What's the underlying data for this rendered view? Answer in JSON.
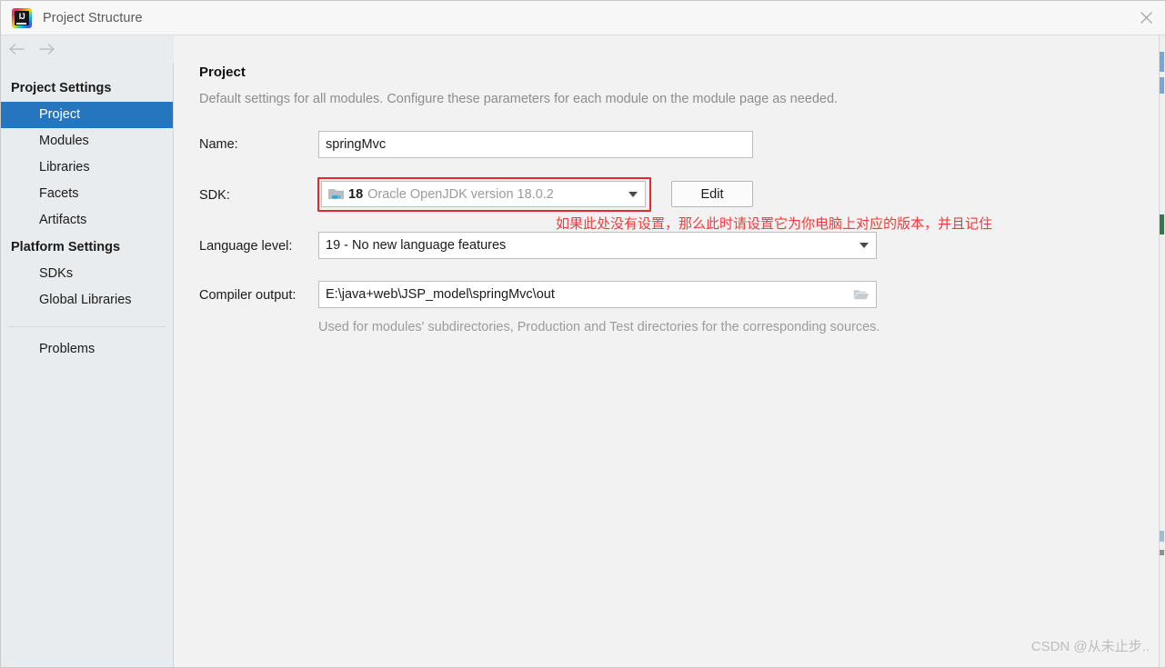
{
  "window": {
    "title": "Project Structure",
    "app_icon": "intellij-idea-icon",
    "icon_letters": "IJ",
    "close_icon": "close-icon"
  },
  "toolbar": {
    "back_icon": "arrow-left-icon",
    "forward_icon": "arrow-right-icon"
  },
  "sidebar": {
    "groups": [
      {
        "label": "Project Settings",
        "items": [
          {
            "label": "Project",
            "selected": true
          },
          {
            "label": "Modules",
            "selected": false
          },
          {
            "label": "Libraries",
            "selected": false
          },
          {
            "label": "Facets",
            "selected": false
          },
          {
            "label": "Artifacts",
            "selected": false
          }
        ]
      },
      {
        "label": "Platform Settings",
        "items": [
          {
            "label": "SDKs",
            "selected": false
          },
          {
            "label": "Global Libraries",
            "selected": false
          }
        ]
      }
    ],
    "problems": {
      "label": "Problems"
    }
  },
  "main": {
    "title": "Project",
    "subtitle": "Default settings for all modules. Configure these parameters for each module on the module page as needed.",
    "name_row": {
      "label": "Name:",
      "value": "springMvc"
    },
    "sdk_row": {
      "label": "SDK:",
      "icon": "jdk-folder-icon",
      "version": "18",
      "description": "Oracle OpenJDK version 18.0.2",
      "dropdown_icon": "chevron-down-icon",
      "edit_button": "Edit"
    },
    "language_level_row": {
      "label": "Language level:",
      "value": "19 - No new language features",
      "dropdown_icon": "chevron-down-icon"
    },
    "compiler_output_row": {
      "label": "Compiler output:",
      "value": "E:\\java+web\\JSP_model\\springMvc\\out",
      "browse_icon": "folder-browse-icon",
      "hint": "Used for modules' subdirectories, Production and Test directories for the corresponding sources."
    }
  },
  "annotation": {
    "text": "如果此处没有设置，那么此时请设置它为你电脑上对应的版本，并且记住",
    "box_color": "#e8282a",
    "text_color": "#f23a3c"
  },
  "watermark": {
    "text": "CSDN @从未止步.."
  },
  "colors": {
    "selection_blue": "#2675bf",
    "sidebar_bg": "#e8ecef",
    "content_bg": "#f2f2f2",
    "title_bg": "#f7f7f7"
  }
}
